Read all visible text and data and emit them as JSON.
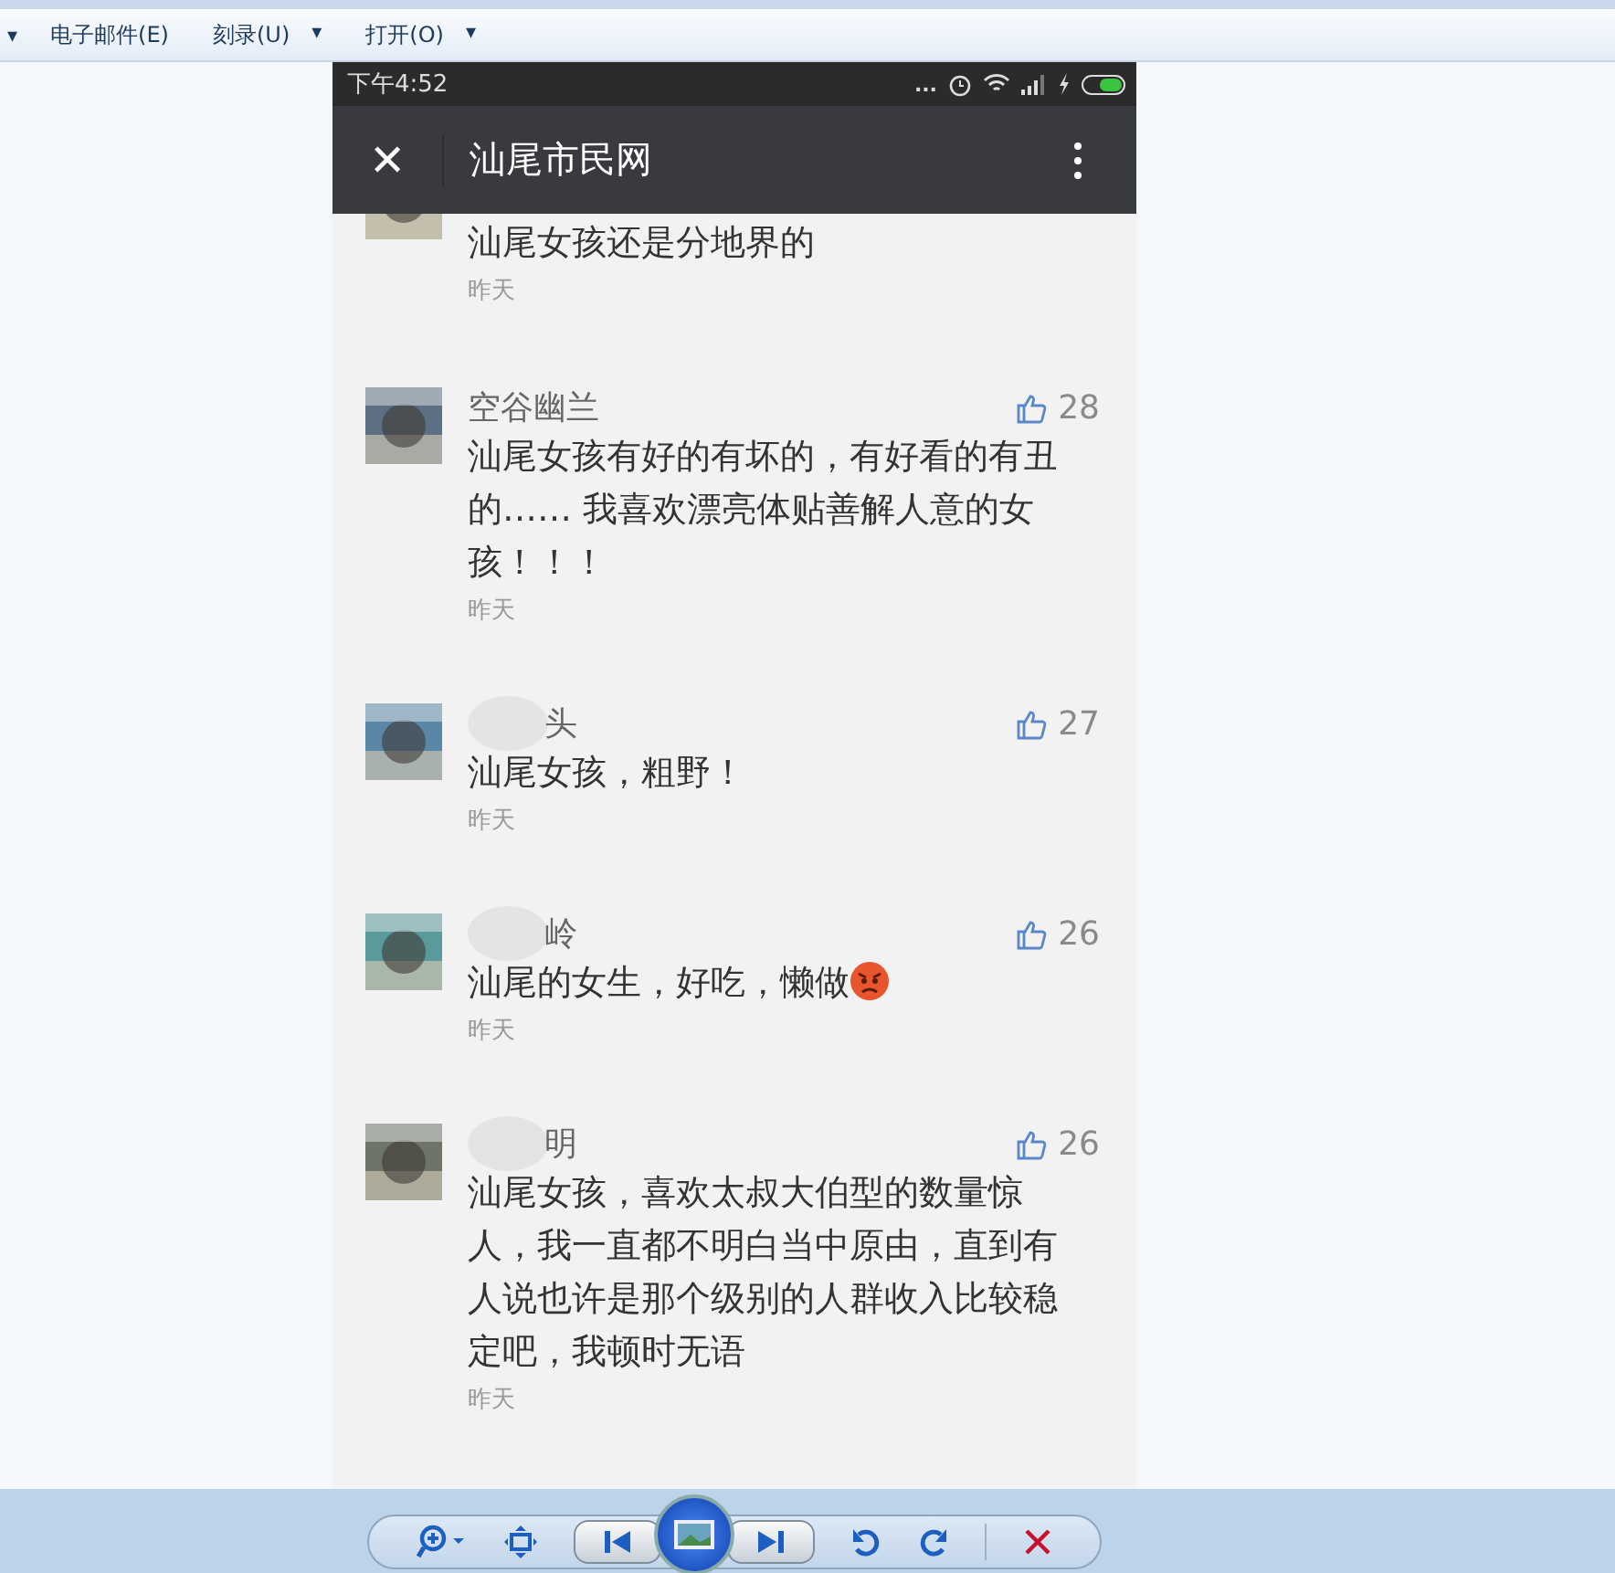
{
  "menu_caret": "▾",
  "menu": [
    {
      "label": "电子邮件(E)",
      "dropdown": false
    },
    {
      "label": "刻录(U)",
      "dropdown": true,
      "caret": "▾"
    },
    {
      "label": "打开(O)",
      "dropdown": true,
      "caret": "▾"
    }
  ],
  "status_bar": {
    "time": "下午4:52",
    "more": "..."
  },
  "header": {
    "close": "✕",
    "title": "汕尾市民网"
  },
  "comments": [
    {
      "text": "汕尾女孩还是分地界的",
      "time": "昨天",
      "redacted": false,
      "emoji": false
    },
    {
      "name": "空谷幽兰",
      "text": "汕尾女孩有好的有坏的，有好看的有丑的…… 我喜欢漂亮体贴善解人意的女孩！！！",
      "time": "昨天",
      "likes": "28",
      "redacted": false,
      "emoji": false
    },
    {
      "name": "头",
      "text": "汕尾女孩，粗野！",
      "time": "昨天",
      "likes": "27",
      "redacted": true,
      "emoji": false
    },
    {
      "name": "岭",
      "text": "汕尾的女生，好吃，懒做",
      "time": "昨天",
      "likes": "26",
      "redacted": true,
      "emoji": true
    },
    {
      "name": "明",
      "text": "汕尾女孩，喜欢太叔大伯型的数量惊人，我一直都不明白当中原由，直到有人说也许是那个级别的人群收入比较稳定吧，我顿时无语",
      "time": "昨天",
      "likes": "26",
      "redacted": true,
      "emoji": false
    }
  ]
}
